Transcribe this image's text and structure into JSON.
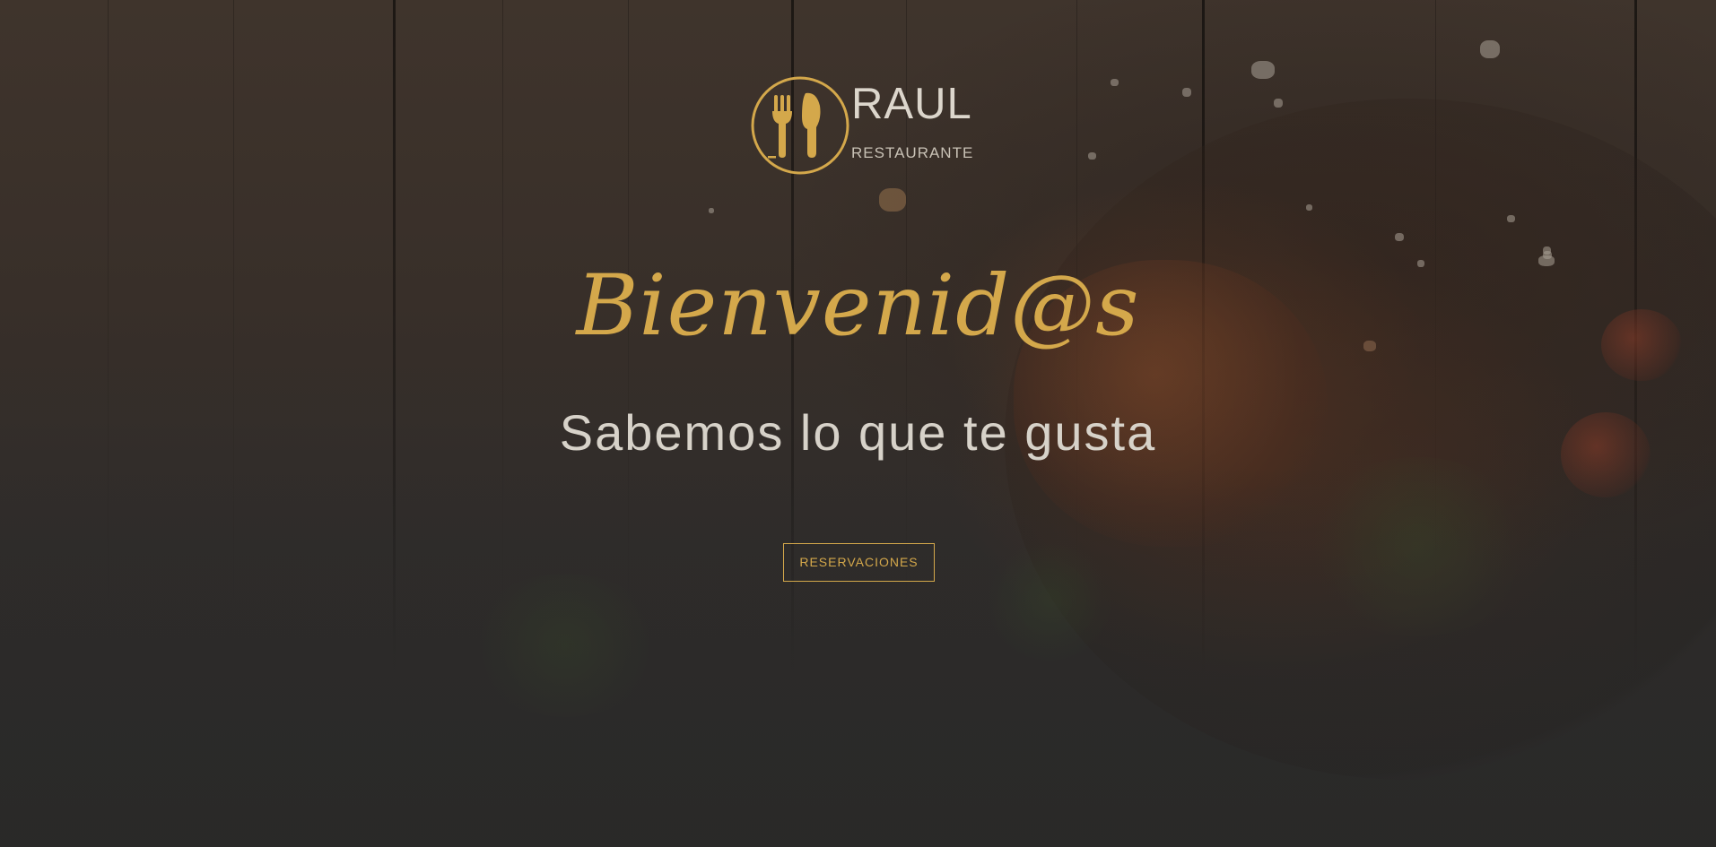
{
  "logo": {
    "name": "RAUL",
    "subtitle": "RESTAURANTE",
    "icon": "fork-knife-icon"
  },
  "hero": {
    "heading": "Bienvenid@s",
    "tagline": "Sabemos lo que te gusta",
    "cta_label": "RESERVACIONES"
  },
  "colors": {
    "accent": "#d4a84b",
    "text_light": "#d7d2c9",
    "background": "#2c2a29"
  }
}
